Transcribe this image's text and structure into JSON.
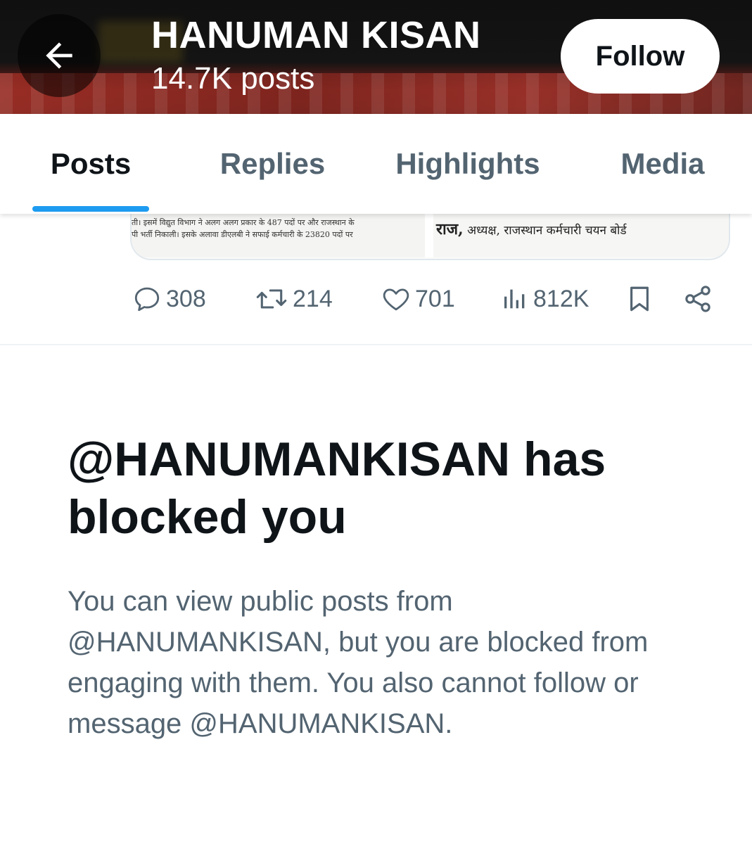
{
  "header": {
    "title": "HANUMAN KISAN",
    "post_count": "14.7K posts",
    "follow_label": "Follow",
    "back_icon": "arrow-left-icon"
  },
  "tabs": [
    {
      "label": "Posts",
      "active": true
    },
    {
      "label": "Replies",
      "active": false
    },
    {
      "label": "Highlights",
      "active": false
    },
    {
      "label": "Media",
      "active": false
    }
  ],
  "post_image": {
    "left_lines": [
      "ती। इसमें विद्युत विभाग ने अलग अलग प्रकार के 487 पदों पर और राजस्थान के",
      "पी भर्ती निकाली। इसके अलावा डीएलबी ने सफाई कर्मचारी के 23820 पदों पर"
    ],
    "right_text_bold": "राज,",
    "right_text": " अध्यक्ष, राजस्थान कर्मचारी चयन बोर्ड"
  },
  "actions": {
    "replies": "308",
    "reposts": "214",
    "likes": "701",
    "views": "812K"
  },
  "blocked": {
    "title": "@HANUMANKISAN has blocked you",
    "description": "You can view public posts from @HANUMANKISAN, but you are blocked from engaging with them. You also cannot follow or message @HANUMANKISAN."
  },
  "colors": {
    "accent": "#1d9bf0",
    "text_primary": "#0f1419",
    "text_secondary": "#536471"
  }
}
